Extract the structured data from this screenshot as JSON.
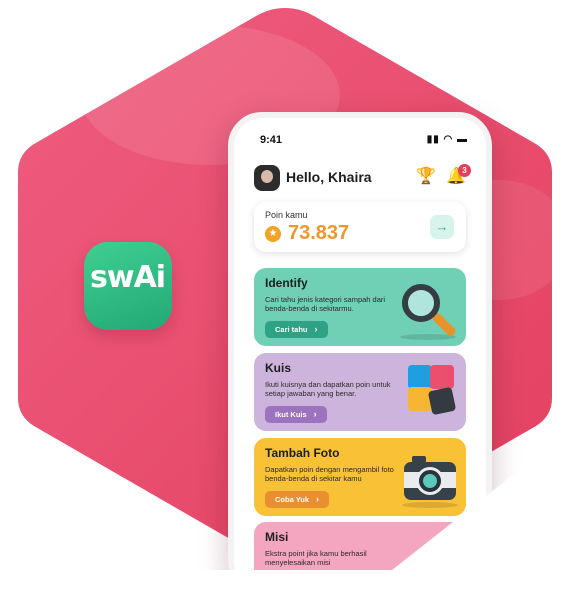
{
  "colors": {
    "background_hex": "#e94a6c",
    "accent": "#f0962a"
  },
  "app_icon": {
    "text": "swAi"
  },
  "phone": {
    "status_time": "9:41",
    "greeting": "Hello, Khaira",
    "notification_count": "3",
    "points": {
      "label": "Poin kamu",
      "value": "73.837"
    },
    "cards": [
      {
        "title": "Identify",
        "description": "Cari tahu jenis kategori sampah dari benda-benda di sekitarmu.",
        "button": "Cari tahu"
      },
      {
        "title": "Kuis",
        "description": "Ikuti kuisnya dan dapatkan poin untuk setiap jawaban yang benar.",
        "button": "Ikut Kuis"
      },
      {
        "title": "Tambah Foto",
        "description": "Dapatkan poin dengan mengambil foto benda-benda di sekitar kamu",
        "button": "Coba Yuk"
      },
      {
        "title": "Misi",
        "description": "Ekstra point jika kamu berhasil menyelesaikan misi"
      }
    ]
  }
}
